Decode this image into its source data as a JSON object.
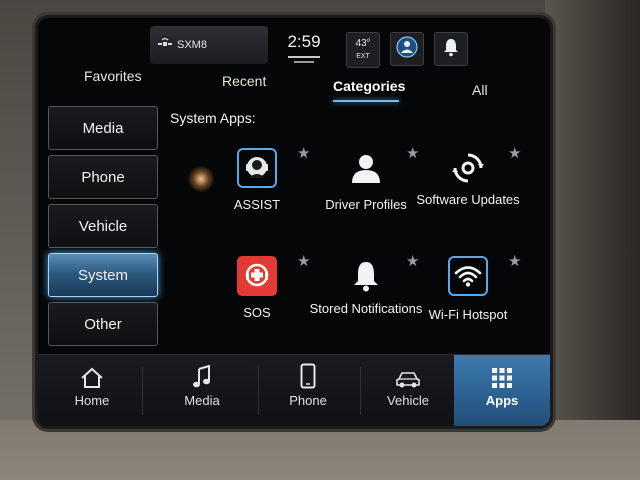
{
  "status_bar": {
    "radio_label": "SXM8",
    "radio_icon": "satellite-icon",
    "time": "2:59",
    "temperature": "43°",
    "temperature_unit": "EXT",
    "profile_icon": "person-badge-icon",
    "notifications_icon": "bell-icon"
  },
  "top_tabs": [
    {
      "label": "Favorites"
    },
    {
      "label": "Recent"
    },
    {
      "label": "Categories",
      "active": true
    },
    {
      "label": "All"
    }
  ],
  "categories": [
    {
      "label": "Media"
    },
    {
      "label": "Phone"
    },
    {
      "label": "Vehicle"
    },
    {
      "label": "System",
      "active": true
    },
    {
      "label": "Other"
    }
  ],
  "section_title": "System Apps:",
  "apps": [
    {
      "label": "ASSIST",
      "icon": "assist-agent-icon",
      "favorite_icon": "star-icon"
    },
    {
      "label": "Driver Profiles",
      "icon": "driver-profile-icon",
      "favorite_icon": "star-icon"
    },
    {
      "label": "Software Updates",
      "icon": "software-update-icon",
      "favorite_icon": "star-icon"
    },
    {
      "label": "SOS",
      "icon": "sos-icon",
      "favorite_icon": "star-icon"
    },
    {
      "label": "Stored Notifications",
      "icon": "bell-icon",
      "favorite_icon": "star-icon"
    },
    {
      "label": "Wi-Fi Hotspot",
      "icon": "wifi-icon",
      "favorite_icon": "star-icon"
    }
  ],
  "bottom_nav": [
    {
      "label": "Home",
      "icon": "home-icon"
    },
    {
      "label": "Media",
      "icon": "music-note-icon"
    },
    {
      "label": "Phone",
      "icon": "phone-icon"
    },
    {
      "label": "Vehicle",
      "icon": "vehicle-icon"
    },
    {
      "label": "Apps",
      "icon": "apps-grid-icon",
      "active": true
    }
  ],
  "colors": {
    "accent": "#4a9ddc",
    "sos_red": "#e33a33",
    "screen_bg": "#050608"
  }
}
